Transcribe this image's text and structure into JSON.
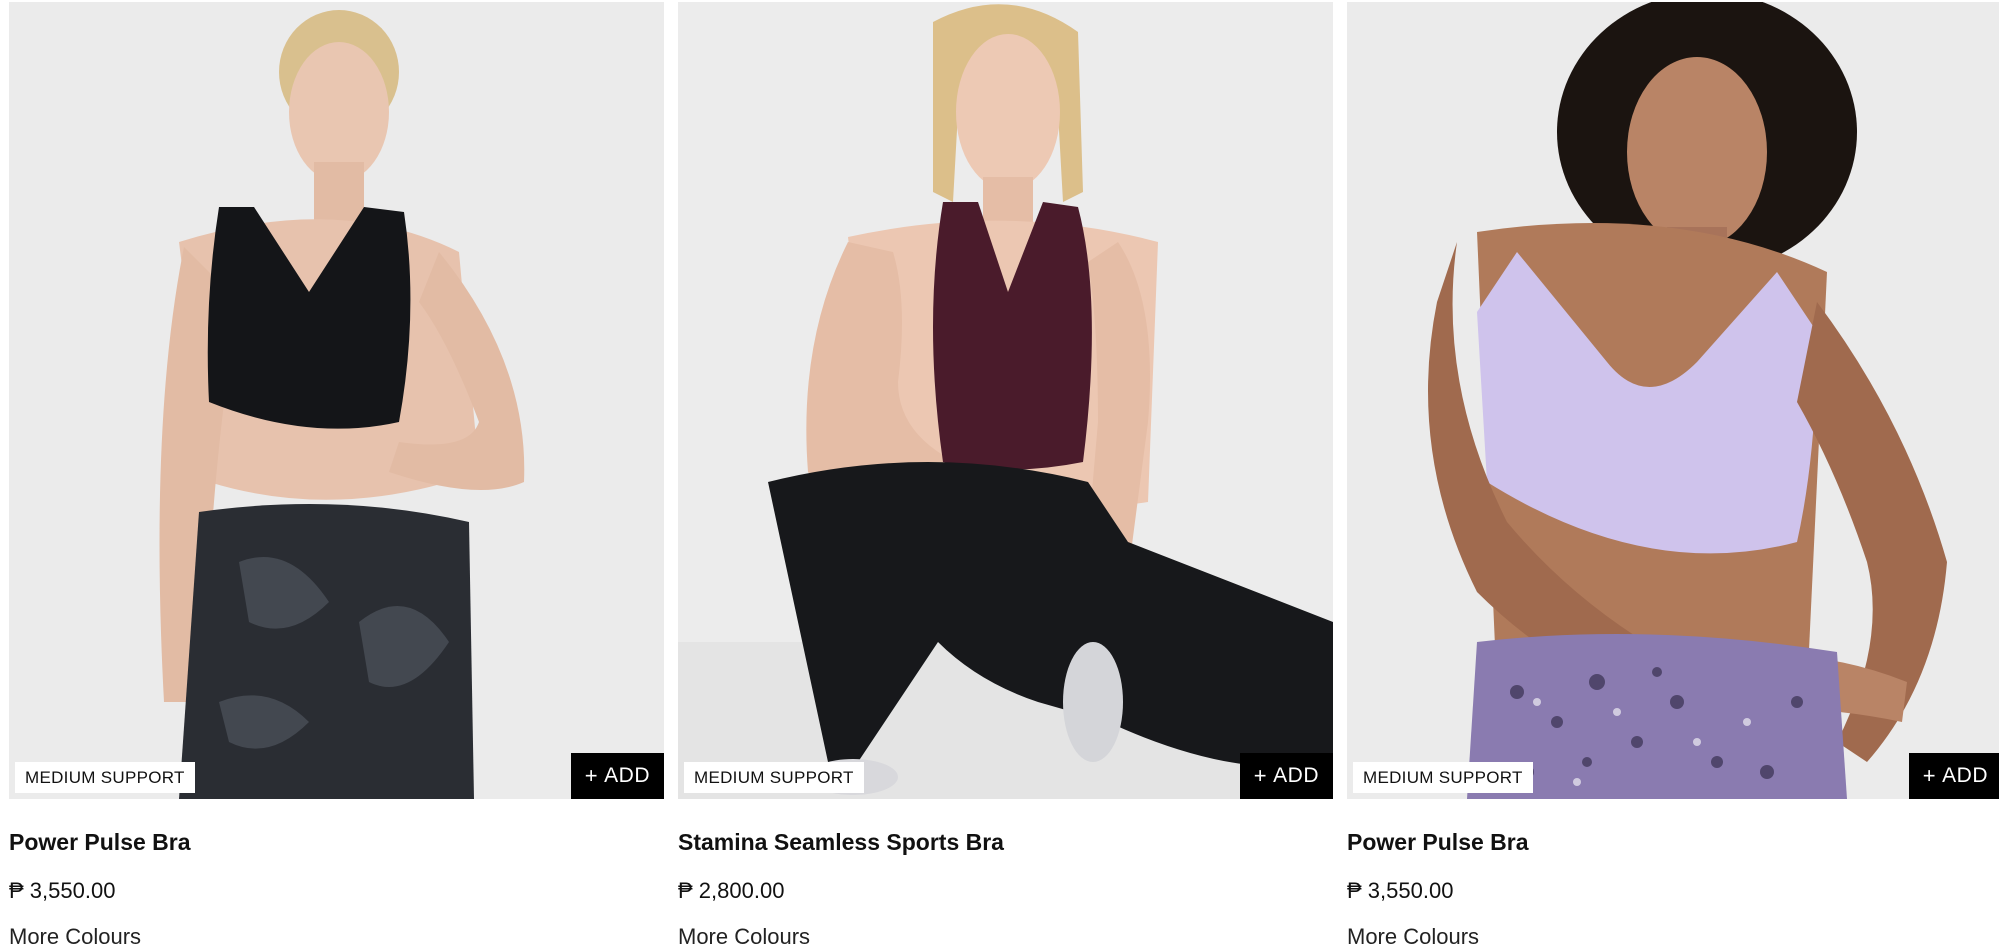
{
  "products": [
    {
      "name": "Power Pulse Bra",
      "price": "₱ 3,550.00",
      "badge": "MEDIUM SUPPORT",
      "add_label": "ADD",
      "add_prefix": "+",
      "more_colours": "More Colours",
      "image": {
        "subject": "woman-black-bra-camo-leggings",
        "bra_color": "#141518",
        "legging_color": "#2a2d33",
        "skin_color": "#e7c2ad",
        "hair_color": "#d9c08e"
      }
    },
    {
      "name": "Stamina Seamless Sports Bra",
      "price": "₱ 2,800.00",
      "badge": "MEDIUM SUPPORT",
      "add_label": "ADD",
      "add_prefix": "+",
      "more_colours": "More Colours",
      "image": {
        "subject": "woman-plum-bra-black-leggings-lunge",
        "bra_color": "#4a1b2b",
        "legging_color": "#17181b",
        "skin_color": "#ecc7b2",
        "hair_color": "#dcbf8a"
      }
    },
    {
      "name": "Power Pulse Bra",
      "price": "₱ 3,550.00",
      "badge": "MEDIUM SUPPORT",
      "add_label": "ADD",
      "add_prefix": "+",
      "more_colours": "More Colours",
      "image": {
        "subject": "woman-lilac-bra-printed-leggings-stretch",
        "bra_color": "#cfc3ec",
        "legging_color": "#8a7bb0",
        "skin_color": "#b07a5a",
        "hair_color": "#1b1410"
      }
    }
  ]
}
